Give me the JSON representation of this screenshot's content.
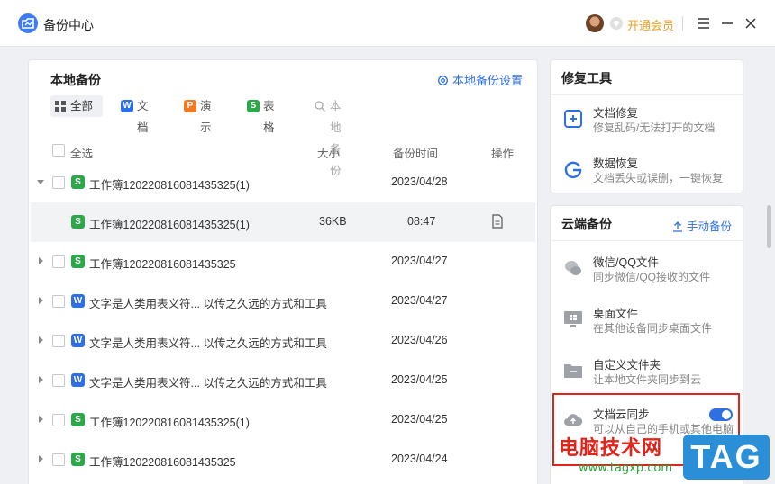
{
  "app": {
    "title": "备份中心",
    "vip_label": "开通会员"
  },
  "local_backup": {
    "title": "本地备份",
    "settings_label": "本地备份设置",
    "tabs": [
      {
        "label": "全部",
        "icon": "grid-icon"
      },
      {
        "label": "文档",
        "icon": "W"
      },
      {
        "label": "演示",
        "icon": "P"
      },
      {
        "label": "表格",
        "icon": "S"
      },
      {
        "label": "本地备份",
        "icon": "search-icon"
      }
    ],
    "columns": {
      "select_all": "全选",
      "size": "大小",
      "time": "备份时间",
      "op": "操作"
    },
    "rows": [
      {
        "type": "S",
        "name": "工作簿120220816081435325(1)",
        "size": "",
        "time": "2023/04/28",
        "expanded": true
      },
      {
        "type": "S",
        "name": "工作簿120220816081435325(1)",
        "size": "36KB",
        "time": "08:47",
        "sub": true
      },
      {
        "type": "S",
        "name": "工作簿120220816081435325",
        "size": "",
        "time": "2023/04/27"
      },
      {
        "type": "W",
        "name": "文字是人类用表义符... 以传之久远的方式和工具",
        "size": "",
        "time": "2023/04/27"
      },
      {
        "type": "W",
        "name": "文字是人类用表义符... 以传之久远的方式和工具",
        "size": "",
        "time": "2023/04/26"
      },
      {
        "type": "W",
        "name": "文字是人类用表义符... 以传之久远的方式和工具",
        "size": "",
        "time": "2023/04/25"
      },
      {
        "type": "S",
        "name": "工作簿120220816081435325(1)",
        "size": "",
        "time": "2023/04/25"
      },
      {
        "type": "S",
        "name": "工作簿120220816081435325",
        "size": "",
        "time": "2023/04/24"
      }
    ]
  },
  "repair_tools": {
    "title": "修复工具",
    "items": [
      {
        "title": "文档修复",
        "desc": "修复乱码/无法打开的文档"
      },
      {
        "title": "数据恢复",
        "desc": "文档丢失或误删，一键恢复"
      }
    ]
  },
  "cloud_backup": {
    "title": "云端备份",
    "manual_label": "手动备份",
    "items": [
      {
        "title": "微信/QQ文件",
        "desc": "同步微信/QQ接收的文件"
      },
      {
        "title": "桌面文件",
        "desc": "在其他设备同步桌面文件"
      },
      {
        "title": "自定义文件夹",
        "desc": "让本地文件夹同步到云"
      },
      {
        "title": "文档云同步",
        "desc": "可以从自己的手机或其他电脑",
        "toggle": true
      }
    ]
  },
  "colors": {
    "accent": "#2f6fe4",
    "highlight": "#e2231a",
    "vip": "#f0a020"
  },
  "watermark": {
    "text": "电脑技术网",
    "url": "www.tagxp.com",
    "tag": "TAG"
  }
}
